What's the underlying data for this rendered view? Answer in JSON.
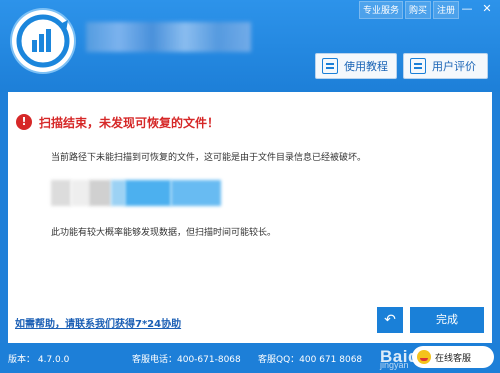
{
  "header": {
    "top_buttons": {
      "pro_service": "专业服务",
      "buy": "购买",
      "register": "注册"
    },
    "window_controls": {
      "minimize": "—",
      "close": "✕"
    },
    "nav": {
      "tutorial": "使用教程",
      "review": "用户评价"
    }
  },
  "dialog": {
    "error_title": "扫描结束，未发现可恢复的文件！",
    "message_1": "当前路径下未能扫描到可恢复的文件，这可能是由于文件目录信息已经被破坏。",
    "message_2": "此功能有较大概率能够发现数据，但扫描时间可能较长。",
    "help_link": "如需帮助，请联系我们获得7*24协助",
    "back_symbol": "↶",
    "done_label": "完成"
  },
  "footer": {
    "version": "版本： 4.7.0.0",
    "phone": "客服电话：400-671-8068",
    "qq": "客服QQ：400 671 8068",
    "customer_service": "在线客服"
  },
  "watermark": {
    "brand": "Baidu经验",
    "sub": "jingyan"
  },
  "colors": {
    "primary_blue": "#1d7fd8",
    "error_red": "#d62828",
    "link_blue": "#1b5fb5"
  }
}
